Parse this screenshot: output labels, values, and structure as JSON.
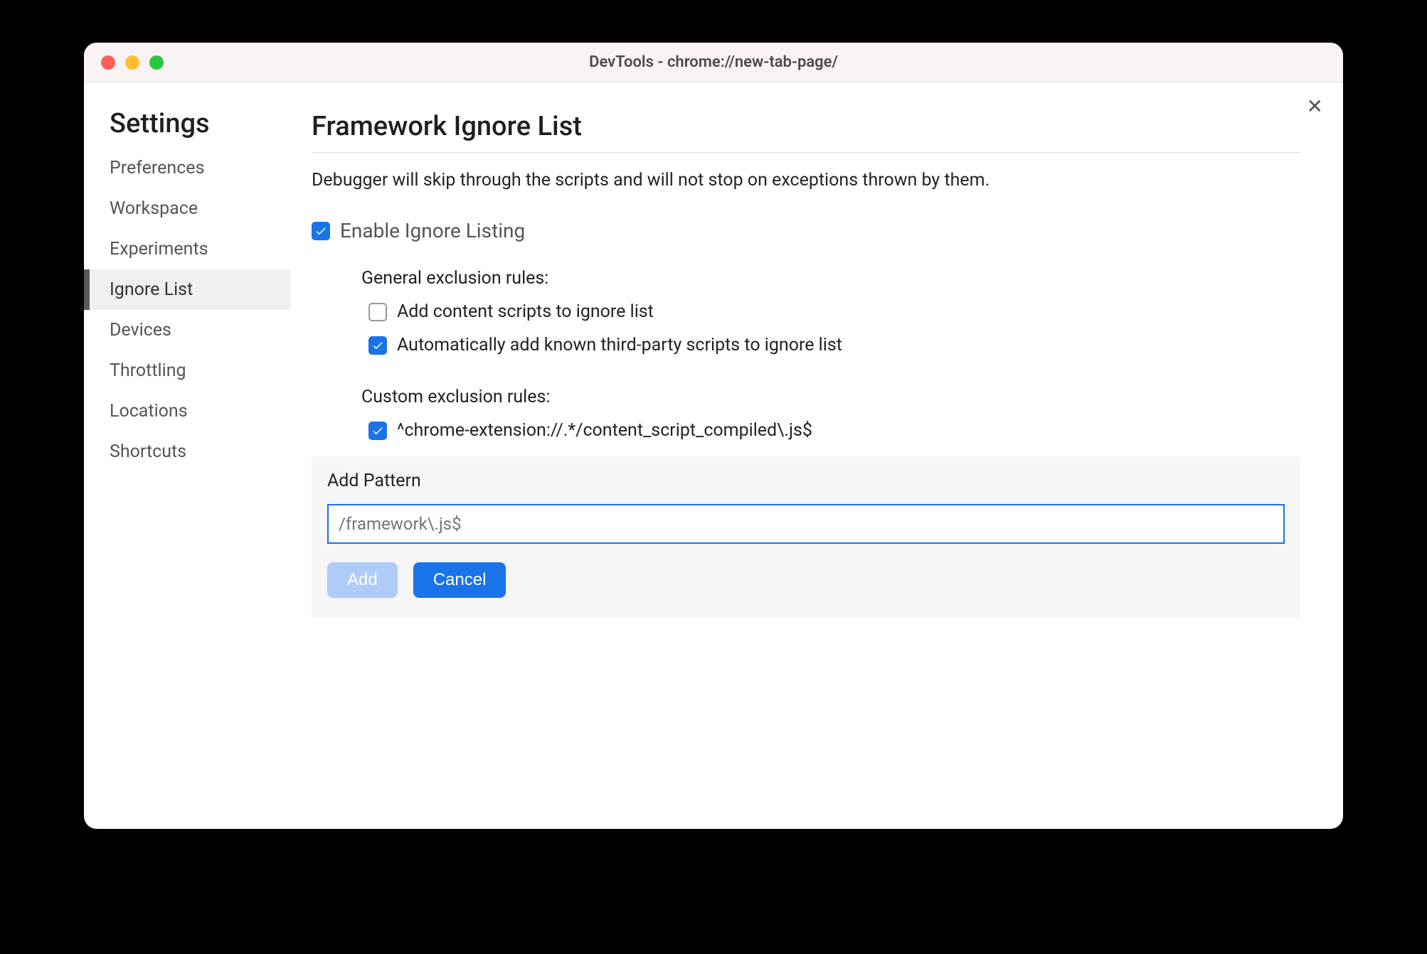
{
  "window": {
    "title": "DevTools - chrome://new-tab-page/"
  },
  "sidebar": {
    "heading": "Settings",
    "items": [
      {
        "label": "Preferences"
      },
      {
        "label": "Workspace"
      },
      {
        "label": "Experiments"
      },
      {
        "label": "Ignore List"
      },
      {
        "label": "Devices"
      },
      {
        "label": "Throttling"
      },
      {
        "label": "Locations"
      },
      {
        "label": "Shortcuts"
      }
    ],
    "active_index": 3
  },
  "page": {
    "title": "Framework Ignore List",
    "description": "Debugger will skip through the scripts and will not stop on exceptions thrown by them.",
    "enable_label": "Enable Ignore Listing",
    "enable_checked": true,
    "general_heading": "General exclusion rules:",
    "general_rules": [
      {
        "label": "Add content scripts to ignore list",
        "checked": false
      },
      {
        "label": "Automatically add known third-party scripts to ignore list",
        "checked": true
      }
    ],
    "custom_heading": "Custom exclusion rules:",
    "custom_rules": [
      {
        "label": "^chrome-extension://.*/content_script_compiled\\.js$",
        "checked": true
      }
    ],
    "add_pattern": {
      "label": "Add Pattern",
      "placeholder": "/framework\\.js$",
      "add_button": "Add",
      "cancel_button": "Cancel"
    }
  },
  "close_symbol": "✕"
}
